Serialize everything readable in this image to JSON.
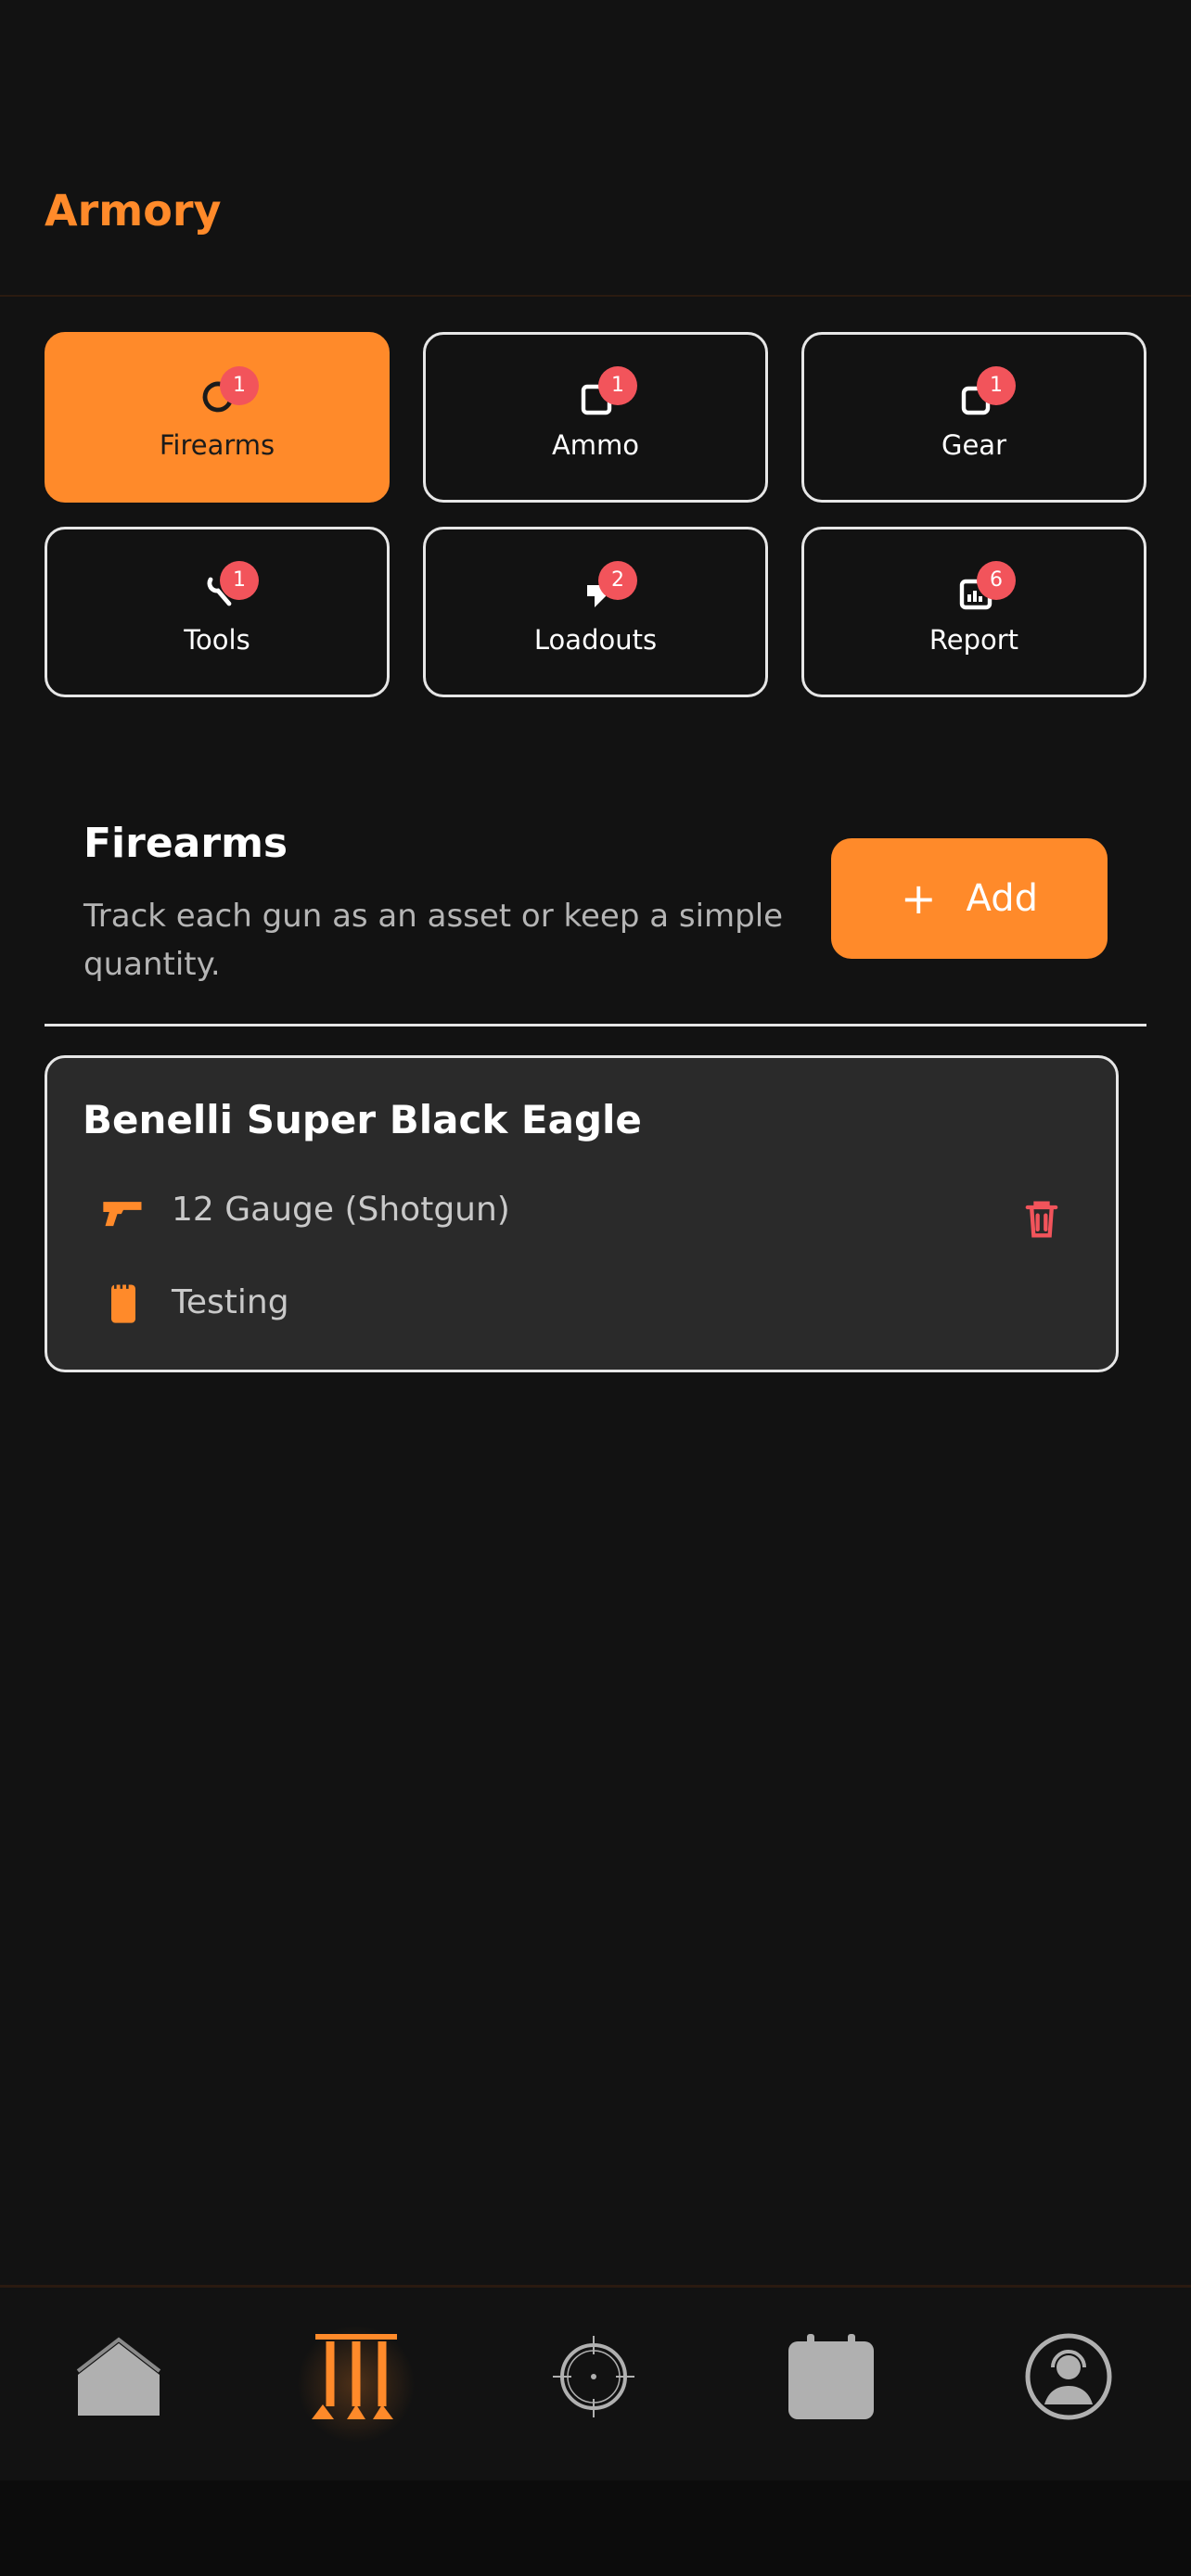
{
  "header": {
    "title": "Armory"
  },
  "categories": [
    {
      "label": "Firearms",
      "badge": "1",
      "icon": "target-icon",
      "active": true
    },
    {
      "label": "Ammo",
      "badge": "1",
      "icon": "box-icon",
      "active": false
    },
    {
      "label": "Gear",
      "badge": "1",
      "icon": "bag-icon",
      "active": false
    },
    {
      "label": "Tools",
      "badge": "1",
      "icon": "wrench-icon",
      "active": false
    },
    {
      "label": "Loadouts",
      "badge": "2",
      "icon": "tag-icon",
      "active": false
    },
    {
      "label": "Report",
      "badge": "6",
      "icon": "chart-icon",
      "active": false
    }
  ],
  "section": {
    "title": "Firearms",
    "subtitle": "Track each gun as an asset or keep a simple quantity.",
    "add_label": "Add"
  },
  "firearms": [
    {
      "name": "Benelli Super Black Eagle",
      "caliber": "12 Gauge (Shotgun)",
      "note": "Testing"
    }
  ],
  "bottom_nav": [
    {
      "name": "home",
      "icon": "home-icon",
      "active": false
    },
    {
      "name": "armory",
      "icon": "gun-rack-icon",
      "active": true
    },
    {
      "name": "range",
      "icon": "crosshair-icon",
      "active": false
    },
    {
      "name": "calendar",
      "icon": "calendar-icon",
      "active": false
    },
    {
      "name": "profile",
      "icon": "user-headset-icon",
      "active": false
    }
  ],
  "colors": {
    "accent": "#FF8A2A",
    "background": "#121212",
    "card": "#2A2A2A",
    "badge": "#F2545B",
    "delete": "#F2545B"
  }
}
